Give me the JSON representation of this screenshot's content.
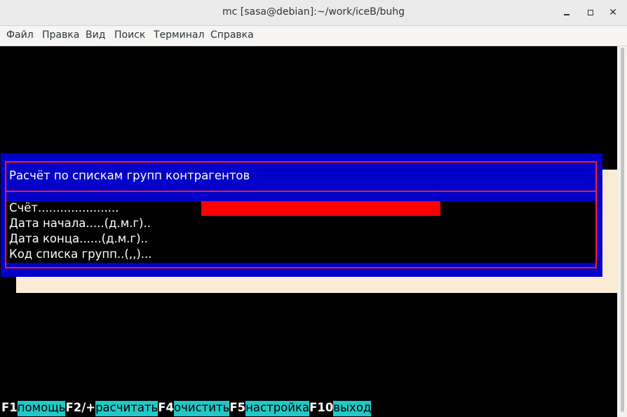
{
  "window": {
    "title": "mc [sasa@debian]:~/work/iceB/buhg",
    "minimize_glyph": "",
    "close_glyph": "✕"
  },
  "menu": [
    "Файл",
    "Правка",
    "Вид",
    "Поиск",
    "Терминал",
    "Справка"
  ],
  "dialog": {
    "title": "Расчёт по спискам групп контрагентов",
    "fields": [
      {
        "label": "Счёт......................",
        "value": ""
      },
      {
        "label": "Дата начала.....(д.м.г)..",
        "value": ""
      },
      {
        "label": "Дата конца......(д.м.г)..",
        "value": ""
      },
      {
        "label": "Код списка групп..(,,)...",
        "value": ""
      }
    ]
  },
  "function_keys": [
    {
      "key": "F1",
      "label": "помощь"
    },
    {
      "key": "F2/+",
      "label": "расчитать"
    },
    {
      "key": "F4",
      "label": "очистить"
    },
    {
      "key": "F5",
      "label": "настройка"
    },
    {
      "key": "F10",
      "label": "выход"
    }
  ],
  "colors": {
    "dialog_bg": "#0000c8",
    "frame": "#ff1a1a",
    "input_bg": "#ff0000",
    "shadow": "#faebd7",
    "fkey_label_bg": "#20c8c8"
  }
}
